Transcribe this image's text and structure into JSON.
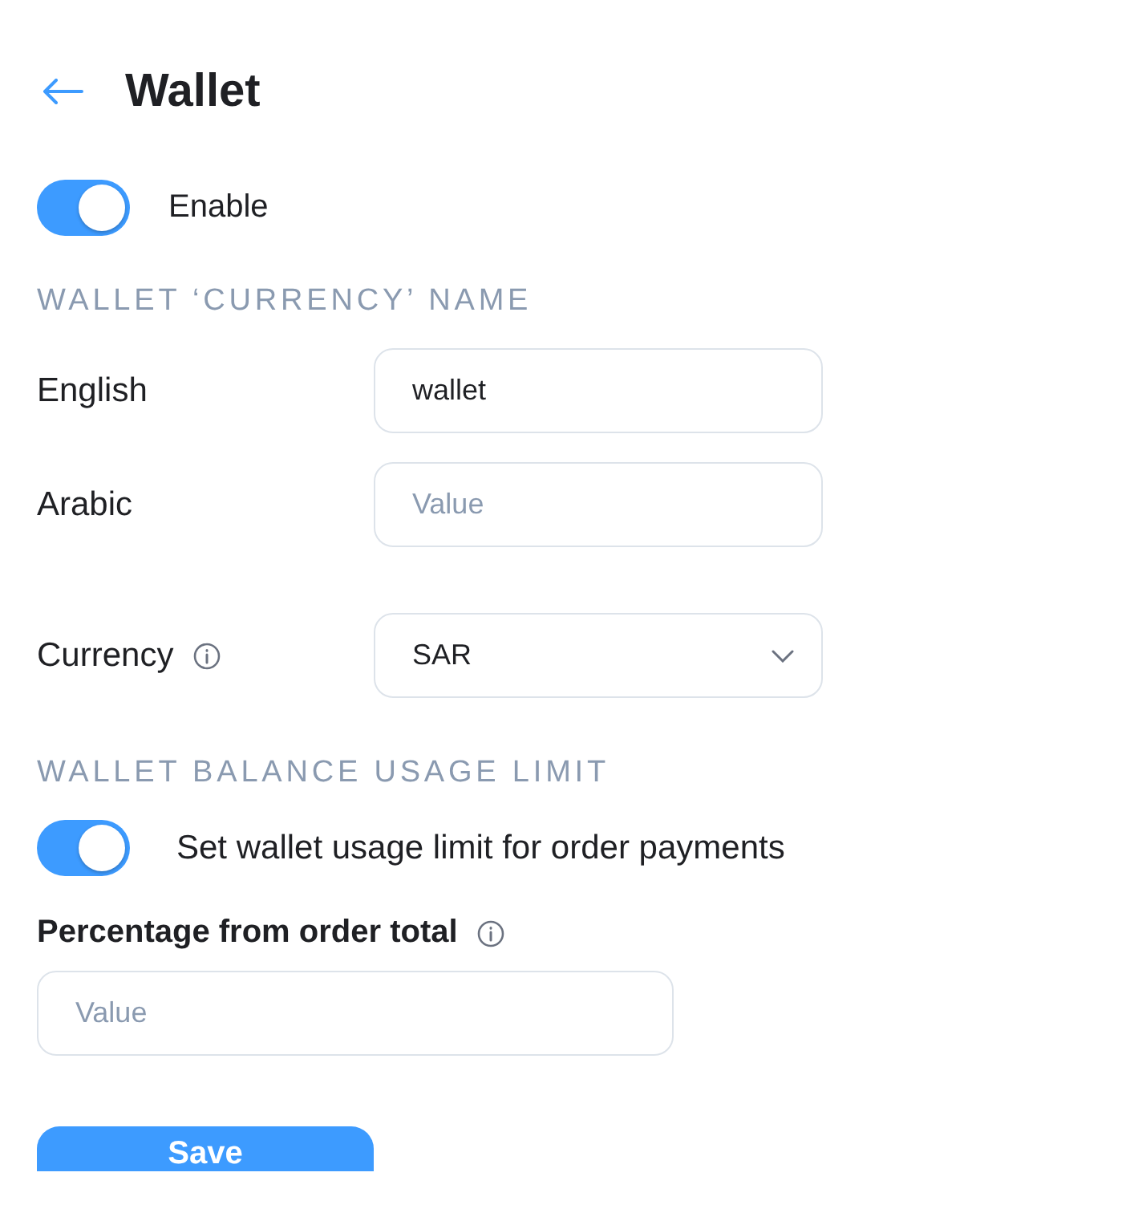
{
  "header": {
    "title": "Wallet"
  },
  "enable": {
    "label": "Enable",
    "on": true
  },
  "name_section": {
    "heading": "WALLET ‘CURRENCY’ NAME",
    "fields": [
      {
        "label": "English",
        "value": "wallet"
      },
      {
        "label": "Arabic",
        "placeholder": "Value"
      }
    ]
  },
  "currency": {
    "label": "Currency",
    "value": "SAR"
  },
  "limit_section": {
    "heading": "WALLET BALANCE USAGE LIMIT",
    "toggle": {
      "label": "Set wallet usage limit for order payments",
      "on": true
    },
    "percentage": {
      "label": "Percentage from order total",
      "placeholder": "Value"
    }
  },
  "save_button": "Save"
}
